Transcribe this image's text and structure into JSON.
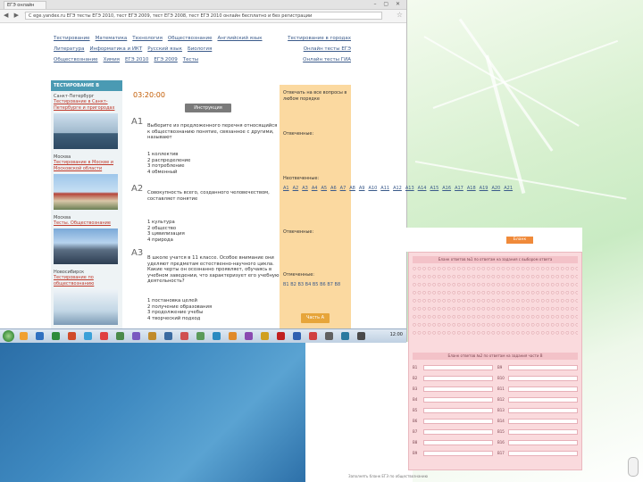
{
  "browser": {
    "tab_title": "ЕГЭ онлайн",
    "url": "С  ege.yandex.ru   ЕГЭ тесты ЕГЭ 2010, тест ЕГЭ 2009, тест ЕГЭ 2008, тест ЕГЭ 2010 онлайн бесплатно и без регистрации",
    "window_controls": "– ▢ ✕"
  },
  "topnav": {
    "row1": [
      "Тестирование",
      "Математика",
      "Технология",
      "Обществознание",
      "Английский язык",
      "История"
    ],
    "row2": [
      "Литература",
      "Информатика и ИКТ",
      "Русский язык",
      "Биология",
      "Физика"
    ],
    "row3": [
      "Обществознание",
      "Химия",
      "ЕГЭ 2010",
      "ЕГЭ 2009",
      "Тесты"
    ]
  },
  "rightlinks": [
    "Тестирование в городах",
    "Онлайн тесты ЕГЭ",
    "Онлайн тесты ГИА"
  ],
  "sidebar": {
    "header": "ТЕСТИРОВАНИЕ В ГОРОДАХ",
    "cities": [
      {
        "name": "Санкт-Петербург",
        "link": "Тестирование в Санкт-Петербурге и пригородах"
      },
      {
        "name": "Москва",
        "link": "Тестирование в Москве и Московской области"
      },
      {
        "name": "Москва",
        "link": "Тесты. Обществознание"
      },
      {
        "name": "Новосибирск",
        "link": "Тестирование по обществознанию"
      }
    ]
  },
  "test": {
    "timer": "03:20:00",
    "instruction_button": "Инструкция",
    "questions": [
      {
        "num": "A1",
        "text": "Выберите из предложенного перечня относящийся к обществознанию понятие, связанное с другими, называют",
        "answers": [
          "1 коллектив",
          "2 распределение",
          "3 потребление",
          "4 обменный"
        ]
      },
      {
        "num": "A2",
        "text": "Совокупность всего, созданного человечеством, составляет понятие",
        "answers": [
          "1 культура",
          "2 общество",
          "3 цивилизация",
          "4 природа"
        ]
      },
      {
        "num": "A3",
        "text": "В школе учатся в 11 классе. Особое внимание они уделяют предметам естественно-научного цикла. Какие черты он осознанно проявляет, обучаясь в учебном заведении, что характеризует его учебную деятельность?",
        "answers": [
          "1 постановка целей",
          "2 получение образования",
          "3 продолжение учебы",
          "4 творческий подход"
        ]
      }
    ]
  },
  "panel": {
    "title": "Отвечать на все вопросы в любом порядке",
    "answered_label": "Отвеченные:",
    "unanswered_label": "Неотвеченные:",
    "links": [
      "A1",
      "A2",
      "A3",
      "A4",
      "A5",
      "A6",
      "A7",
      "A8",
      "A9",
      "A10",
      "A11",
      "A12",
      "A13",
      "A14",
      "A15",
      "A16",
      "A17",
      "A18",
      "A19",
      "A20",
      "A21"
    ],
    "answered2_label": "Отвеченные:",
    "marked_label": "Отмеченные:",
    "marked_links": [
      "B1",
      "B2",
      "B3",
      "B4",
      "B5",
      "B6",
      "B7",
      "B8"
    ],
    "button": "Часть А"
  },
  "taskbar": {
    "clock": "12:00"
  },
  "form": {
    "button": "Бланк",
    "header1": "Бланк ответов №1 по ответам на задания с выбором ответа",
    "header2": "Бланк ответов №2 по ответам на задания части В",
    "footer": "Заполнять бланк ЕГЭ по обществознанию"
  },
  "colors": {
    "accent": "#4a9ab3",
    "panel_bg": "#fbd9a0",
    "form_bg": "#fadadd",
    "timer": "#c25a00"
  }
}
